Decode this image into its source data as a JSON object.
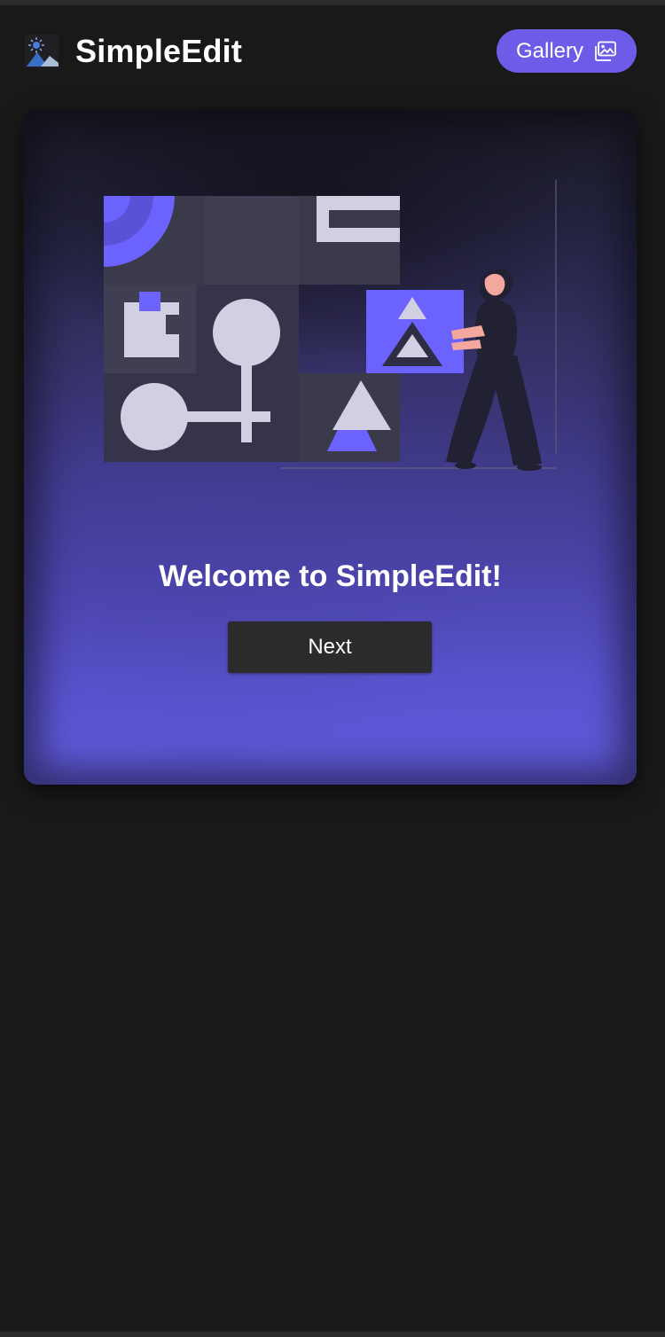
{
  "header": {
    "app_title": "SimpleEdit",
    "logo_icon": "image-edit-logo-icon",
    "gallery_button_label": "Gallery",
    "gallery_icon": "image-gallery-icon"
  },
  "welcome_card": {
    "illustration": "person-arranging-shapes-illustration",
    "title": "Welcome to SimpleEdit!",
    "next_button_label": "Next"
  },
  "colors": {
    "background": "#191919",
    "accent": "#6c5ce7",
    "button_dark": "#2b2b2b",
    "text": "#ffffff"
  }
}
